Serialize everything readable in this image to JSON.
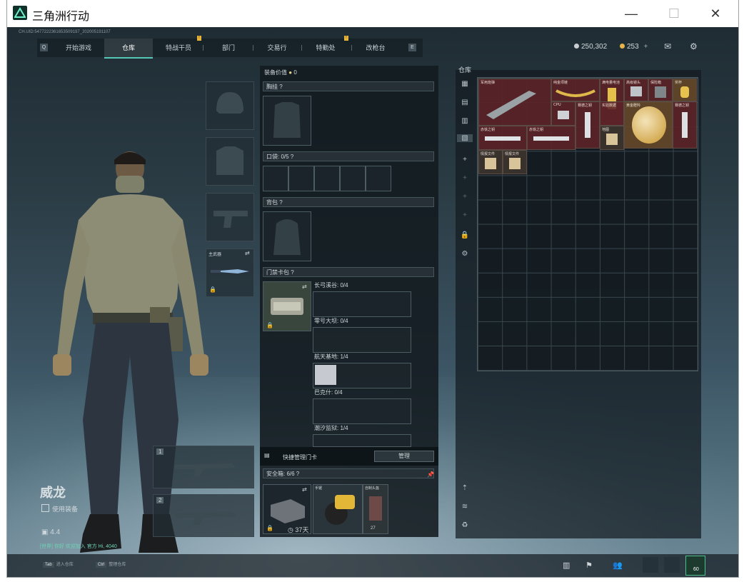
{
  "window": {
    "title": "三角洲行动",
    "minimize_label": "—",
    "maximize_label": "☐",
    "close_label": "✕"
  },
  "uid_text": "CH.UID:5477222361653509197_202005191107",
  "nav": {
    "prev_key": "Q",
    "next_key": "E",
    "tabs": [
      {
        "label": "开始游戏",
        "active": false
      },
      {
        "label": "仓库",
        "active": true
      },
      {
        "label": "特战干员",
        "active": false,
        "badge": "!"
      },
      {
        "label": "部门",
        "active": false
      },
      {
        "label": "交易行",
        "active": false
      },
      {
        "label": "特勤处",
        "active": false,
        "badge": "!"
      },
      {
        "label": "改枪台",
        "active": false
      }
    ]
  },
  "currency": {
    "silver": "250,302",
    "gold": "253",
    "add": "+"
  },
  "equipment_value": {
    "label": "装备价值",
    "value": "0"
  },
  "sections": {
    "chest_rig": "胸挂",
    "pockets": "口袋: 0/5",
    "backpack": "背包",
    "keycard_pack": "门禁卡包",
    "quick_manage": "快捷管理门卡",
    "manage_button": "管理",
    "safe_box": "安全箱: 6/6"
  },
  "keycard_slots": [
    {
      "label": "长弓溪谷: 0/4"
    },
    {
      "label": "零号大坝: 0/4"
    },
    {
      "label": "航天基地: 1/4"
    },
    {
      "label": "巴克什: 0/4"
    },
    {
      "label": "潮汐监狱: 1/4"
    }
  ],
  "safe_box_items": {
    "case_timer": "37天",
    "tool_label": "手锯",
    "bag_label": "自制头盔",
    "bag_count": "27"
  },
  "weapon_slots": {
    "primary_label": "主武器",
    "slot1": "1",
    "slot2": "2"
  },
  "character": {
    "name": "威龙",
    "sub": "使用装备",
    "level": "4.4",
    "chat": "[世界] 你好 欢迎加入 官方 Hi, 4040"
  },
  "stash": {
    "title": "仓库",
    "items": [
      {
        "label": "军用炮弹",
        "tone": "red"
      },
      {
        "label": "纯金项链",
        "tone": "red"
      },
      {
        "label": "满电量电池",
        "tone": "red"
      },
      {
        "label": "高级镜头",
        "tone": "red"
      },
      {
        "label": "保险箱",
        "tone": "red"
      },
      {
        "label": "奖杯",
        "tone": "gold"
      },
      {
        "label": "CPU",
        "tone": "red"
      },
      {
        "label": "赛德之钥",
        "tone": "red"
      },
      {
        "label": "实验数据",
        "tone": "red"
      },
      {
        "label": "黄金瞪羚",
        "tone": "gold"
      },
      {
        "label": "赛德之钥",
        "tone": "red"
      },
      {
        "label": "赤铁之钥",
        "tone": "red"
      },
      {
        "label": "赤铁之钥",
        "tone": "red"
      },
      {
        "label": "钥匙",
        "tone": "plain"
      },
      {
        "label": "地图",
        "tone": "plain"
      },
      {
        "label": "情报文件",
        "tone": "plain"
      },
      {
        "label": "情报文件",
        "tone": "plain"
      }
    ]
  },
  "bottom": {
    "tab_hint": "进入仓库",
    "tab_key": "Tab",
    "ctrl_hint": "整理仓库",
    "ctrl_key": "Ctrl",
    "level_badge": "60"
  }
}
